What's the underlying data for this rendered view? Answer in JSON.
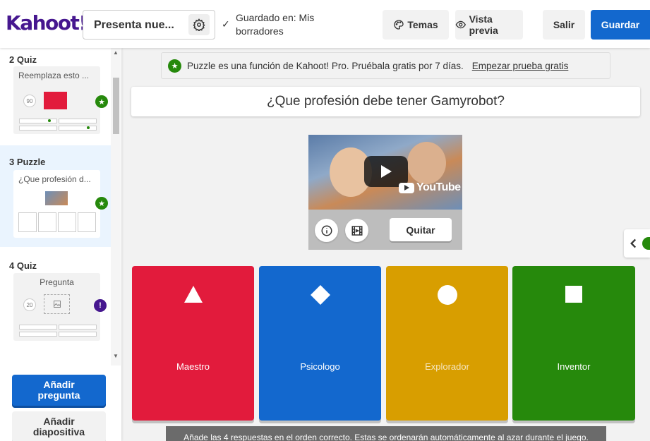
{
  "header": {
    "logo": "Kahoot!",
    "title": "Presenta nue...",
    "saved_text": "Guardado en: Mis borradores",
    "themes_label": "Temas",
    "preview_label": "Vista previa",
    "exit_label": "Salir",
    "save_label": "Guardar"
  },
  "sidebar": {
    "slides": [
      {
        "label": "2  Quiz",
        "card_title": "Reemplaza esto ...",
        "time": "90"
      },
      {
        "label": "3  Puzzle",
        "card_title": "¿Que profesión d..."
      },
      {
        "label": "4  Quiz",
        "card_title": "Pregunta",
        "time": "20"
      }
    ],
    "add_question": "Añadir pregunta",
    "add_slide": "Añadir diapositiva"
  },
  "promo": {
    "text": "Puzzle es una función de Kahoot! Pro. Pruébala gratis por 7 días.",
    "link": "Empezar prueba gratis"
  },
  "question": "¿Que profesión debe tener Gamyrobot?",
  "media": {
    "remove_label": "Quitar",
    "video_brand": "YouTube"
  },
  "answers": [
    {
      "label": "Maestro",
      "shape": "triangle",
      "color": "#e21b3c"
    },
    {
      "label": "Psicologo",
      "shape": "diamond",
      "color": "#1368ce"
    },
    {
      "label": "Explorador",
      "shape": "circle",
      "color": "#d89e00"
    },
    {
      "label": "Inventor",
      "shape": "square",
      "color": "#26890c"
    }
  ],
  "toast": "Añade las 4 respuestas en el orden correcto. Estas se ordenarán automáticamente al azar durante el juego."
}
